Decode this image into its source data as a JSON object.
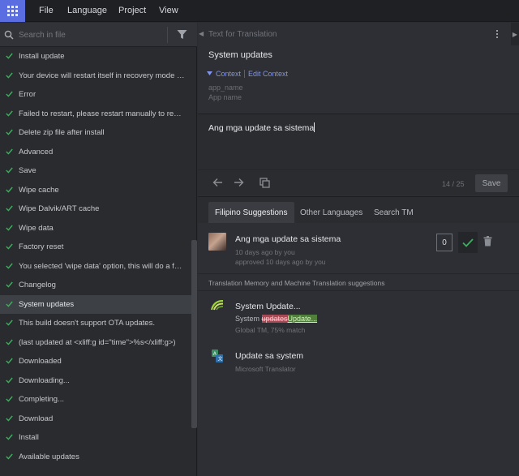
{
  "menubar": {
    "items": [
      "File",
      "Language",
      "Project",
      "View"
    ]
  },
  "left_panel": {
    "search_placeholder": "Search in file",
    "strings": [
      {
        "label": "Install update",
        "active": false
      },
      {
        "label": "Your device will restart itself in recovery mode to...",
        "active": false
      },
      {
        "label": "Error",
        "active": false
      },
      {
        "label": "Failed to restart, please restart manually to reco...",
        "active": false
      },
      {
        "label": "Delete zip file after install",
        "active": false
      },
      {
        "label": "Advanced",
        "active": false
      },
      {
        "label": "Save",
        "active": false
      },
      {
        "label": "Wipe cache",
        "active": false
      },
      {
        "label": "Wipe Dalvik/ART cache",
        "active": false
      },
      {
        "label": "Wipe data",
        "active": false
      },
      {
        "label": "Factory reset",
        "active": false
      },
      {
        "label": "You selected 'wipe data' option, this will do a fac...",
        "active": false
      },
      {
        "label": "Changelog",
        "active": false
      },
      {
        "label": "System updates",
        "active": true
      },
      {
        "label": "This build doesn't support OTA updates.",
        "active": false
      },
      {
        "label": "(last updated at <xliff:g id=\"time\">%s</xliff:g>)",
        "active": false
      },
      {
        "label": "Downloaded",
        "active": false
      },
      {
        "label": "Downloading...",
        "active": false
      },
      {
        "label": "Completing...",
        "active": false
      },
      {
        "label": "Download",
        "active": false
      },
      {
        "label": "Install",
        "active": false
      },
      {
        "label": "Available updates",
        "active": false
      }
    ]
  },
  "source": {
    "header": "Text for Translation",
    "text": "System updates",
    "context_label": "Context",
    "edit_context_label": "Edit Context",
    "meta_key": "app_name",
    "meta_value": "App name"
  },
  "editor": {
    "translation": "Ang mga update sa sistema",
    "counter": "14 / 25",
    "save_label": "Save"
  },
  "tabs": {
    "items": [
      "Filipino Suggestions",
      "Other Languages",
      "Search TM"
    ],
    "active_index": 0
  },
  "suggestion": {
    "text": "Ang mga update sa sistema",
    "added": "10 days ago by you",
    "approved": "approved 10 days ago by you",
    "votes": "0"
  },
  "tm": {
    "header": "Translation Memory and Machine Translation suggestions",
    "item1": {
      "title": "System Update...",
      "diff_prefix": "System ",
      "diff_deleted": "updates",
      "diff_inserted": "Update...",
      "meta": "Global TM, 75% match"
    },
    "item2": {
      "title": "Update sa system",
      "meta": "Microsoft Translator"
    }
  },
  "colors": {
    "accent": "#5b6ee1",
    "link": "#7f95f0",
    "check_green": "#3fae5e",
    "diff_delete": "#a64a55",
    "diff_insert": "#4f7f3a"
  }
}
